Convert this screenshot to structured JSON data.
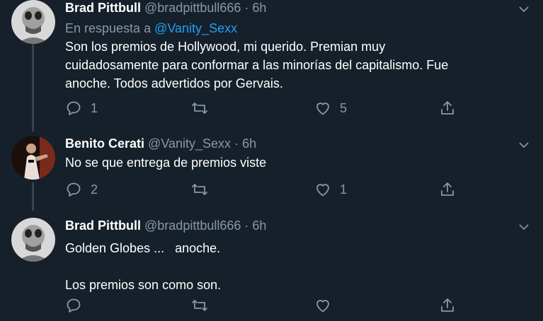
{
  "tweets": [
    {
      "name": "Brad Pittbull",
      "handle": "@bradpittbull666",
      "sep": "·",
      "time": "6h",
      "reply_prefix": "En respuesta a",
      "reply_mention": "@Vanity_Sexx",
      "text": "Son los premios de Hollywood, mi querido. Premian muy\ncuidadosamente para conformar a las minorías del capitalismo. Fue\nanoche. Todos advertidos por Gervais.",
      "replies": "1",
      "retweets": "",
      "likes": "5"
    },
    {
      "name": "Benito Cerati",
      "handle": "@Vanity_Sexx",
      "sep": "·",
      "time": "6h",
      "text": "No se que entrega de premios viste",
      "replies": "2",
      "retweets": "",
      "likes": "1"
    },
    {
      "name": "Brad Pittbull",
      "handle": "@bradpittbull666",
      "sep": "·",
      "time": "6h",
      "text": "Golden Globes ...   anoche.\n\nLos premios son como son.",
      "replies": "",
      "retweets": "",
      "likes": ""
    }
  ],
  "colors": {
    "background": "#15202b",
    "secondary_text": "#8899a6",
    "link": "#1da1f2",
    "thread_line": "#38444d"
  },
  "icons": [
    "chevron-down-icon",
    "reply-icon",
    "retweet-icon",
    "like-icon",
    "share-icon"
  ]
}
